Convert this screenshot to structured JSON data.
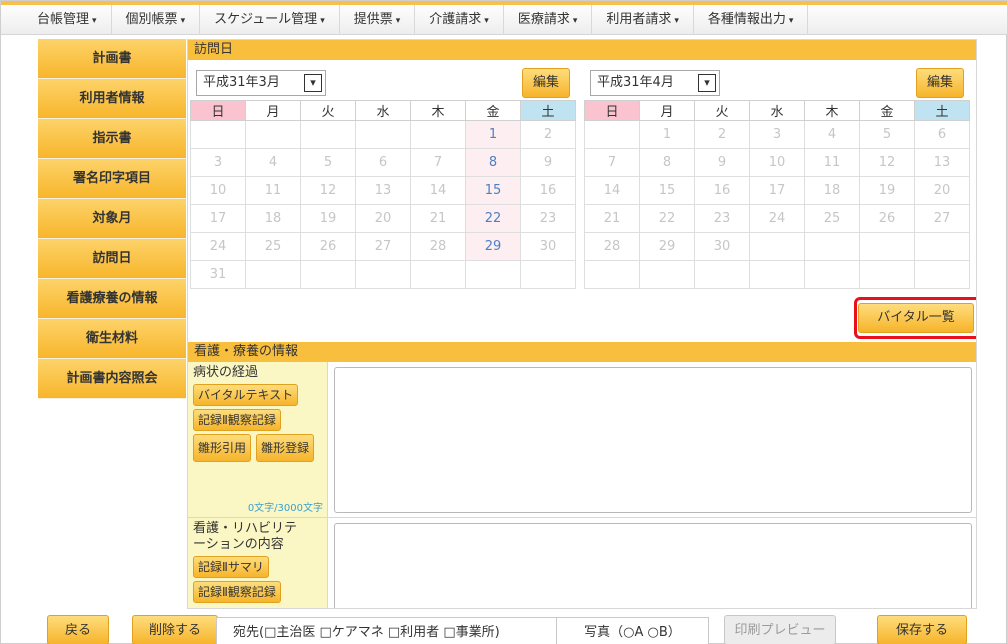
{
  "menu": [
    {
      "label": "台帳管理"
    },
    {
      "label": "個別帳票"
    },
    {
      "label": "スケジュール管理"
    },
    {
      "label": "提供票"
    },
    {
      "label": "介護請求"
    },
    {
      "label": "医療請求"
    },
    {
      "label": "利用者請求"
    },
    {
      "label": "各種情報出力"
    }
  ],
  "sidenav": [
    {
      "label": "計画書"
    },
    {
      "label": "利用者情報"
    },
    {
      "label": "指示書"
    },
    {
      "label": "署名印字項目"
    },
    {
      "label": "対象月"
    },
    {
      "label": "訪問日"
    },
    {
      "label": "看護療養の情報"
    },
    {
      "label": "衛生材料"
    },
    {
      "label": "計画書内容照会"
    }
  ],
  "visit_section": {
    "title": "訪問日"
  },
  "weekdays": [
    "日",
    "月",
    "火",
    "水",
    "木",
    "金",
    "土"
  ],
  "calendars": [
    {
      "month": "平成31年3月",
      "edit_label": "編集",
      "weeks": [
        [
          "",
          "",
          "",
          "",
          "",
          "1",
          "2"
        ],
        [
          "3",
          "4",
          "5",
          "6",
          "7",
          "8",
          "9"
        ],
        [
          "10",
          "11",
          "12",
          "13",
          "14",
          "15",
          "16"
        ],
        [
          "17",
          "18",
          "19",
          "20",
          "21",
          "22",
          "23"
        ],
        [
          "24",
          "25",
          "26",
          "27",
          "28",
          "29",
          "30"
        ],
        [
          "31",
          "",
          "",
          "",
          "",
          "",
          ""
        ]
      ],
      "visit_days": [
        "1",
        "8",
        "15",
        "22",
        "29"
      ]
    },
    {
      "month": "平成31年4月",
      "edit_label": "編集",
      "weeks": [
        [
          "",
          "1",
          "2",
          "3",
          "4",
          "5",
          "6"
        ],
        [
          "7",
          "8",
          "9",
          "10",
          "11",
          "12",
          "13"
        ],
        [
          "14",
          "15",
          "16",
          "17",
          "18",
          "19",
          "20"
        ],
        [
          "21",
          "22",
          "23",
          "24",
          "25",
          "26",
          "27"
        ],
        [
          "28",
          "29",
          "30",
          "",
          "",
          "",
          ""
        ],
        [
          "",
          "",
          "",
          "",
          "",
          "",
          ""
        ]
      ],
      "visit_days": []
    }
  ],
  "vital_list_label": "バイタル一覧",
  "nursing_section": {
    "title": "看護・療養の情報",
    "condition": {
      "label": "病状の経過",
      "buttons": [
        "バイタルテキスト",
        "記録Ⅱ観察記録"
      ],
      "template_quote": "雛形引用",
      "template_register": "雛形登録",
      "count": "0文字/3000文字"
    },
    "rehab": {
      "label": "看護・リハビリテーションの内容",
      "buttons": [
        "記録Ⅱサマリ",
        "記録Ⅱ観察記録"
      ]
    }
  },
  "bottom": {
    "back": "戻る",
    "delete": "削除する",
    "destination": "宛先(□主治医 □ケアマネ □利用者 □事業所)",
    "photo": "写真（○A ○B）",
    "print_preview": "印刷プレビュー",
    "save": "保存する"
  }
}
